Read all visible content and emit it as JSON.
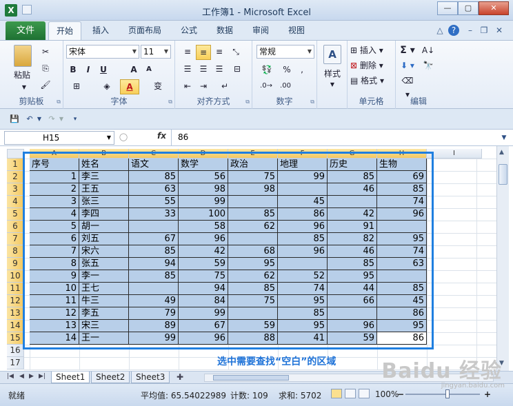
{
  "window": {
    "title": "工作簿1 - Microsoft Excel",
    "app_icon": "X"
  },
  "tabs": {
    "file": "文件",
    "items": [
      "开始",
      "插入",
      "页面布局",
      "公式",
      "数据",
      "审阅",
      "视图"
    ]
  },
  "ribbon": {
    "clipboard": {
      "label": "剪贴板",
      "paste": "粘贴"
    },
    "font": {
      "label": "字体",
      "name": "宋体",
      "size": "11",
      "bold": "B",
      "italic": "I",
      "underline": "U",
      "grow": "A",
      "shrink": "A",
      "font_color": "A",
      "wen": "变"
    },
    "align": {
      "label": "对齐方式"
    },
    "number": {
      "label": "数字",
      "format": "常规",
      "percent": "%"
    },
    "styles": {
      "label": "样式"
    },
    "cells": {
      "label": "单元格",
      "insert": "插入",
      "delete": "删除",
      "format": "格式"
    },
    "edit": {
      "label": "编辑"
    }
  },
  "formula_bar": {
    "cell_ref": "H15",
    "fx": "fx",
    "value": "86"
  },
  "grid": {
    "columns": [
      "A",
      "B",
      "C",
      "D",
      "E",
      "F",
      "G",
      "H",
      "I"
    ],
    "row_numbers": [
      "1",
      "2",
      "3",
      "4",
      "5",
      "6",
      "7",
      "8",
      "9",
      "10",
      "11",
      "12",
      "13",
      "14",
      "15",
      "16",
      "17"
    ],
    "header": [
      "序号",
      "姓名",
      "语文",
      "数学",
      "政治",
      "地理",
      "历史",
      "生物"
    ],
    "rows": [
      [
        "1",
        "李三",
        "85",
        "56",
        "75",
        "99",
        "85",
        "69"
      ],
      [
        "2",
        "王五",
        "63",
        "98",
        "98",
        "",
        "46",
        "85"
      ],
      [
        "3",
        "张三",
        "55",
        "99",
        "",
        "45",
        "",
        "74"
      ],
      [
        "4",
        "李四",
        "33",
        "100",
        "85",
        "86",
        "42",
        "96"
      ],
      [
        "5",
        "胡一",
        "",
        "58",
        "62",
        "96",
        "91",
        ""
      ],
      [
        "6",
        "刘五",
        "67",
        "96",
        "",
        "85",
        "82",
        "95"
      ],
      [
        "7",
        "宋六",
        "85",
        "42",
        "68",
        "96",
        "46",
        "74"
      ],
      [
        "8",
        "张五",
        "94",
        "59",
        "95",
        "",
        "85",
        "63"
      ],
      [
        "9",
        "李一",
        "85",
        "75",
        "62",
        "52",
        "95",
        ""
      ],
      [
        "10",
        "王七",
        "",
        "94",
        "85",
        "74",
        "44",
        "85"
      ],
      [
        "11",
        "牛三",
        "49",
        "84",
        "75",
        "95",
        "66",
        "45"
      ],
      [
        "12",
        "李五",
        "79",
        "99",
        "",
        "85",
        "",
        "86"
      ],
      [
        "13",
        "宋三",
        "89",
        "67",
        "59",
        "95",
        "96",
        "95"
      ],
      [
        "14",
        "王一",
        "99",
        "96",
        "88",
        "41",
        "59",
        "86"
      ]
    ]
  },
  "annotation": "选中需要查找“空白”的区域",
  "sheets": [
    "Sheet1",
    "Sheet2",
    "Sheet3"
  ],
  "status": {
    "ready": "就绪",
    "average": "平均值: 65.54022989",
    "count": "计数: 109",
    "sum": "求和: 5702",
    "zoom": "100%"
  },
  "watermark": {
    "main": "Baidu 经验",
    "sub": "jingyan.baidu.com"
  }
}
